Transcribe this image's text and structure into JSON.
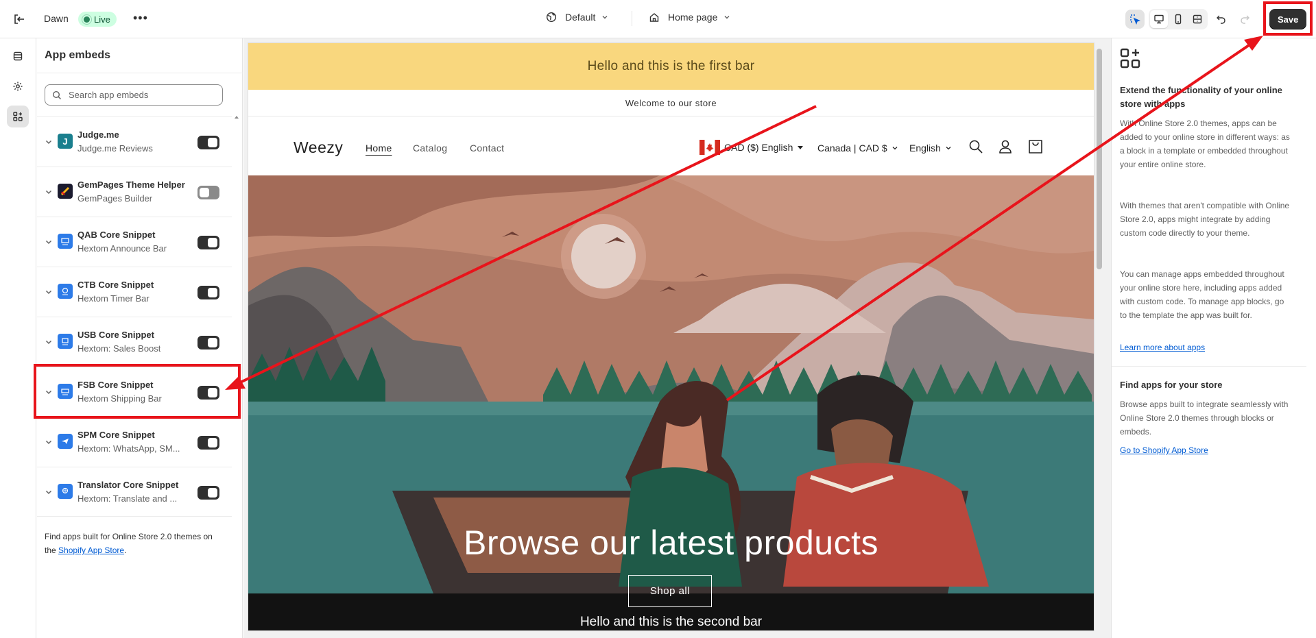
{
  "topbar": {
    "theme_name": "Dawn",
    "live_label": "Live",
    "more_label": "•••",
    "template_label": "Default",
    "page_label": "Home page",
    "save_label": "Save"
  },
  "panel": {
    "title": "App embeds",
    "search_placeholder": "Search app embeds",
    "apps": [
      {
        "name": "Judge.me",
        "sub": "Judge.me Reviews",
        "enabled": true
      },
      {
        "name": "GemPages Theme Helper",
        "sub": "GemPages Builder",
        "enabled": false
      },
      {
        "name": "QAB Core Snippet",
        "sub": "Hextom Announce Bar",
        "enabled": true
      },
      {
        "name": "CTB Core Snippet",
        "sub": "Hextom Timer Bar",
        "enabled": true
      },
      {
        "name": "USB Core Snippet",
        "sub": "Hextom: Sales Boost",
        "enabled": true
      },
      {
        "name": "FSB Core Snippet",
        "sub": "Hextom Shipping Bar",
        "enabled": true
      },
      {
        "name": "SPM Core Snippet",
        "sub": "Hextom: WhatsApp, SM...",
        "enabled": true
      },
      {
        "name": "Translator Core Snippet",
        "sub": "Hextom: Translate and ...",
        "enabled": true
      }
    ],
    "footer_text": "Find apps built for Online Store 2.0 themes on the ",
    "footer_link": "Shopify App Store",
    "footer_end": "."
  },
  "preview": {
    "bar1": "Hello and this is the first bar",
    "welcome": "Welcome to our store",
    "logo": "Weezy",
    "nav": [
      "Home",
      "Catalog",
      "Contact"
    ],
    "currency_1": "CAD ($) English",
    "currency_2": "Canada | CAD $",
    "language": "English",
    "hero_title": "Browse our latest products",
    "shop_button": "Shop all",
    "bar2": "Hello and this is the second bar"
  },
  "right_panel": {
    "heading_1": "Extend the functionality of your online store with apps",
    "para_1": "With Online Store 2.0 themes, apps can be added to your online store in different ways: as a block in a template or embedded throughout your entire online store.",
    "para_2": "With themes that aren't compatible with Online Store 2.0, apps might integrate by adding custom code directly to your theme.",
    "para_3": "You can manage apps embedded throughout your online store here, including apps added with custom code. To manage app blocks, go to the template the app was built for.",
    "link_1": "Learn more about apps",
    "heading_2": "Find apps for your store",
    "para_4": "Browse apps built to integrate seamlessly with Online Store 2.0 themes through blocks or embeds.",
    "link_2": "Go to Shopify App Store"
  },
  "colors": {
    "annotation_red": "#e8141b",
    "accent_link": "#005bd3",
    "live_green": "#29845a",
    "bar1_yellow": "#f9d77e"
  }
}
